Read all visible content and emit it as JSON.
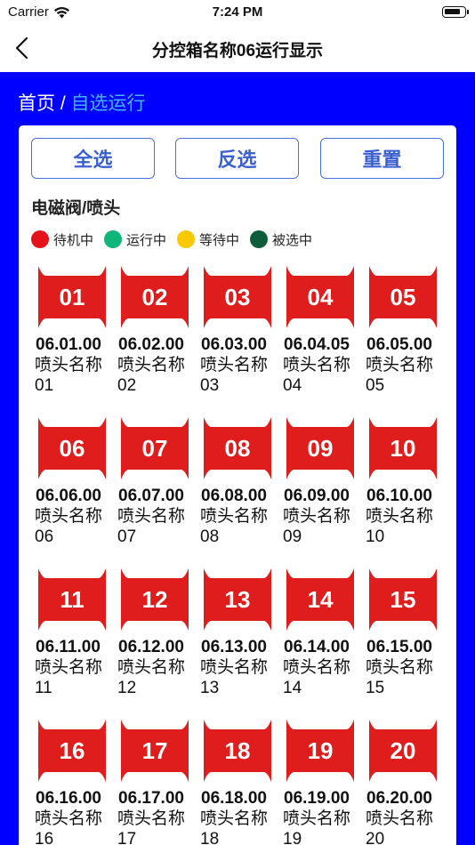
{
  "status_bar": {
    "carrier": "Carrier",
    "time": "7:24 PM"
  },
  "nav": {
    "title": "分控箱名称06运行显示",
    "back_icon": "chevron-left-icon"
  },
  "breadcrumb": {
    "home": "首页",
    "separator": " / ",
    "current": "自选运行"
  },
  "buttons": {
    "select_all": "全选",
    "invert": "反选",
    "reset": "重置"
  },
  "section_title": "电磁阀/喷头",
  "legend": [
    {
      "label": "待机中",
      "color": "#e5121b"
    },
    {
      "label": "运行中",
      "color": "#10b57a"
    },
    {
      "label": "等待中",
      "color": "#f8c800"
    },
    {
      "label": "被选中",
      "color": "#0e5c3a"
    }
  ],
  "colors": {
    "background": "#0000ff",
    "tile": "#e01d1d",
    "breadcrumb_current": "#44b6ff",
    "button_border": "#4a6fd9"
  },
  "nozzles": [
    {
      "num": "01",
      "code": "06.01.00",
      "name": "喷头名称01"
    },
    {
      "num": "02",
      "code": "06.02.00",
      "name": "喷头名称02"
    },
    {
      "num": "03",
      "code": "06.03.00",
      "name": "喷头名称03"
    },
    {
      "num": "04",
      "code": "06.04.05",
      "name": "喷头名称04"
    },
    {
      "num": "05",
      "code": "06.05.00",
      "name": "喷头名称05"
    },
    {
      "num": "06",
      "code": "06.06.00",
      "name": "喷头名称06"
    },
    {
      "num": "07",
      "code": "06.07.00",
      "name": "喷头名称07"
    },
    {
      "num": "08",
      "code": "06.08.00",
      "name": "喷头名称08"
    },
    {
      "num": "09",
      "code": "06.09.00",
      "name": "喷头名称09"
    },
    {
      "num": "10",
      "code": "06.10.00",
      "name": "喷头名称10"
    },
    {
      "num": "11",
      "code": "06.11.00",
      "name": "喷头名称11"
    },
    {
      "num": "12",
      "code": "06.12.00",
      "name": "喷头名称12"
    },
    {
      "num": "13",
      "code": "06.13.00",
      "name": "喷头名称13"
    },
    {
      "num": "14",
      "code": "06.14.00",
      "name": "喷头名称14"
    },
    {
      "num": "15",
      "code": "06.15.00",
      "name": "喷头名称15"
    },
    {
      "num": "16",
      "code": "06.16.00",
      "name": "喷头名称16"
    },
    {
      "num": "17",
      "code": "06.17.00",
      "name": "喷头名称17"
    },
    {
      "num": "18",
      "code": "06.18.00",
      "name": "喷头名称18"
    },
    {
      "num": "19",
      "code": "06.19.00",
      "name": "喷头名称19"
    },
    {
      "num": "20",
      "code": "06.20.00",
      "name": "喷头名称20"
    }
  ]
}
